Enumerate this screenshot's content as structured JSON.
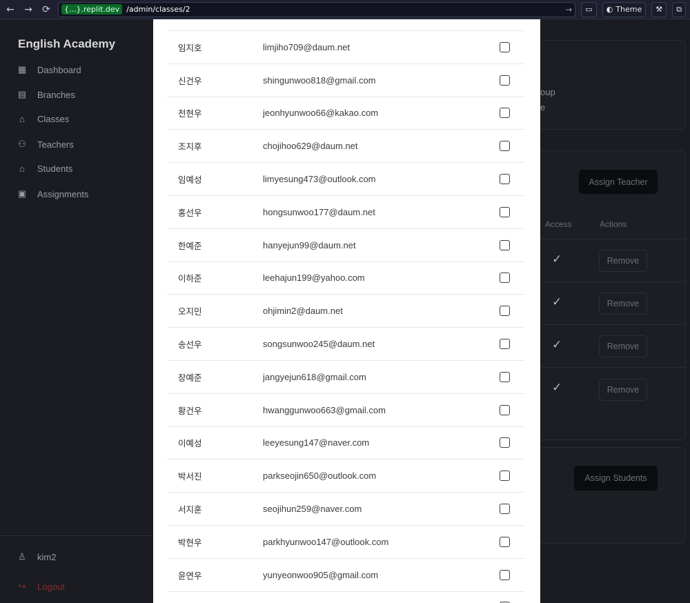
{
  "browser": {
    "domain_badge": "{...}.replit.dev",
    "url_path": "/admin/classes/2",
    "theme_label": "Theme"
  },
  "sidebar": {
    "brand": "English Academy",
    "items": [
      {
        "label": "Dashboard",
        "icon": "dashboard-icon"
      },
      {
        "label": "Branches",
        "icon": "building-icon"
      },
      {
        "label": "Classes",
        "icon": "graduation-cap-icon"
      },
      {
        "label": "Teachers",
        "icon": "users-icon"
      },
      {
        "label": "Students",
        "icon": "graduation-cap-icon"
      },
      {
        "label": "Assignments",
        "icon": "clipboard-icon"
      }
    ],
    "user": "kim2",
    "logout": "Logout"
  },
  "background": {
    "frag_1": "oup",
    "frag_2": "e",
    "assign_teacher": "Assign Teacher",
    "col_access": "Access",
    "col_actions": "Actions",
    "remove_label": "Remove",
    "assign_students": "Assign Students"
  },
  "modal": {
    "students": [
      {
        "name": "임지호",
        "email": "limjiho709@daum.net",
        "checked": false
      },
      {
        "name": "신건우",
        "email": "shingunwoo818@gmail.com",
        "checked": false
      },
      {
        "name": "전현우",
        "email": "jeonhyunwoo66@kakao.com",
        "checked": false
      },
      {
        "name": "조지후",
        "email": "chojihoo629@daum.net",
        "checked": false
      },
      {
        "name": "임예성",
        "email": "limyesung473@outlook.com",
        "checked": false
      },
      {
        "name": "홍선우",
        "email": "hongsunwoo177@daum.net",
        "checked": false
      },
      {
        "name": "한예준",
        "email": "hanyejun99@daum.net",
        "checked": false
      },
      {
        "name": "이하준",
        "email": "leehajun199@yahoo.com",
        "checked": false
      },
      {
        "name": "오지민",
        "email": "ohjimin2@daum.net",
        "checked": false
      },
      {
        "name": "송선우",
        "email": "songsunwoo245@daum.net",
        "checked": false
      },
      {
        "name": "장예준",
        "email": "jangyejun618@gmail.com",
        "checked": false
      },
      {
        "name": "황건우",
        "email": "hwanggunwoo663@gmail.com",
        "checked": false
      },
      {
        "name": "이예성",
        "email": "leeyesung147@naver.com",
        "checked": false
      },
      {
        "name": "박서진",
        "email": "parkseojin650@outlook.com",
        "checked": false
      },
      {
        "name": "서지훈",
        "email": "seojihun259@naver.com",
        "checked": false
      },
      {
        "name": "박현우",
        "email": "parkhyunwoo147@outlook.com",
        "checked": false
      },
      {
        "name": "윤연우",
        "email": "yunyeonwoo905@gmail.com",
        "checked": false
      }
    ]
  }
}
